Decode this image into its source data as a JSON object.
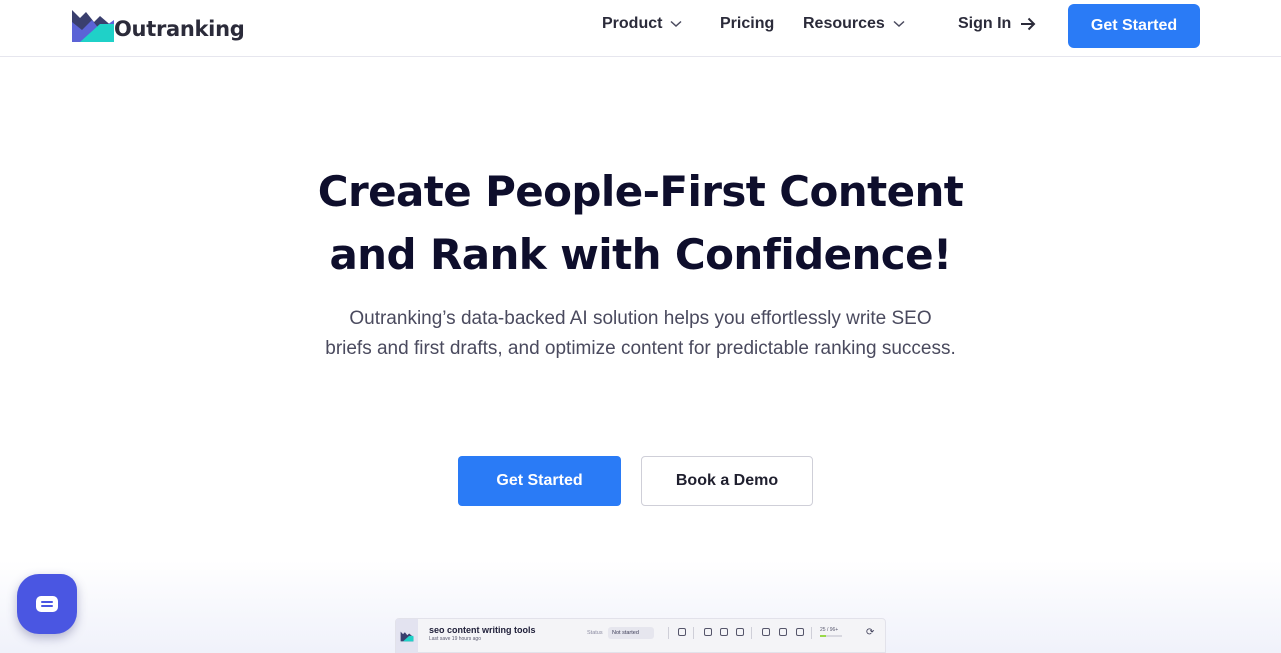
{
  "brand": {
    "name": "Outranking"
  },
  "nav": {
    "items": [
      {
        "label": "Product",
        "has_dropdown": true
      },
      {
        "label": "Pricing",
        "has_dropdown": false
      },
      {
        "label": "Resources",
        "has_dropdown": true
      }
    ],
    "sign_in": "Sign In",
    "cta": "Get Started"
  },
  "hero": {
    "title_line1": "Create People-First Content",
    "title_line2": "and Rank with Confidence!",
    "subtitle": "Outranking’s data-backed AI solution helps you effortlessly write SEO briefs and first drafts, and optimize content for predictable ranking success.",
    "primary_button": "Get Started",
    "secondary_button": "Book a Demo"
  },
  "preview": {
    "doc_title": "seo content writing tools",
    "last_saved": "Last save 19 hours ago",
    "status_label": "Status",
    "status_value": "Not started",
    "score_text": "25 / 96+",
    "score_fraction": 0.26
  },
  "colors": {
    "accent": "#2a7bf6",
    "chat_bubble": "#4a56e2",
    "heading": "#0e0e2c"
  },
  "icons": [
    "chevron-down-icon",
    "arrow-right-icon",
    "chat-icon",
    "refresh-icon"
  ]
}
